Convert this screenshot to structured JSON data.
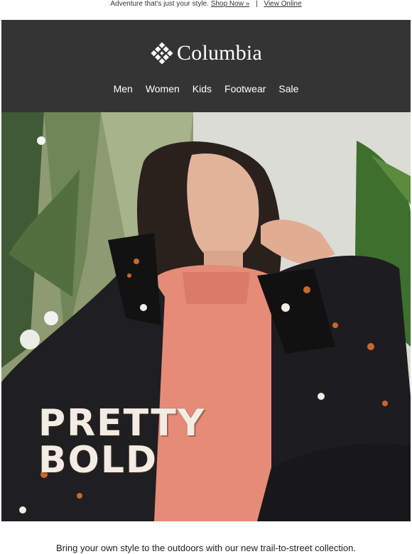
{
  "preheader": {
    "tagline": "Adventure that's just your style.",
    "shop_link": "Shop Now »",
    "separator": "|",
    "view_online": "View Online"
  },
  "header": {
    "brand": "Columbia",
    "logo_icon": "columbia-diamond-logo-icon",
    "nav": [
      "Men",
      "Women",
      "Kids",
      "Footwear",
      "Sale"
    ]
  },
  "hero": {
    "headline_line1": "PRETTY",
    "headline_line2": "BOLD"
  },
  "body": {
    "intro": "Bring your own style to the outdoors with our new trail-to-street collection."
  },
  "colors": {
    "header_bg": "#343434",
    "sweater": "#e58b78",
    "jacket": "#1f1f21",
    "headline": "#f3ece4"
  }
}
